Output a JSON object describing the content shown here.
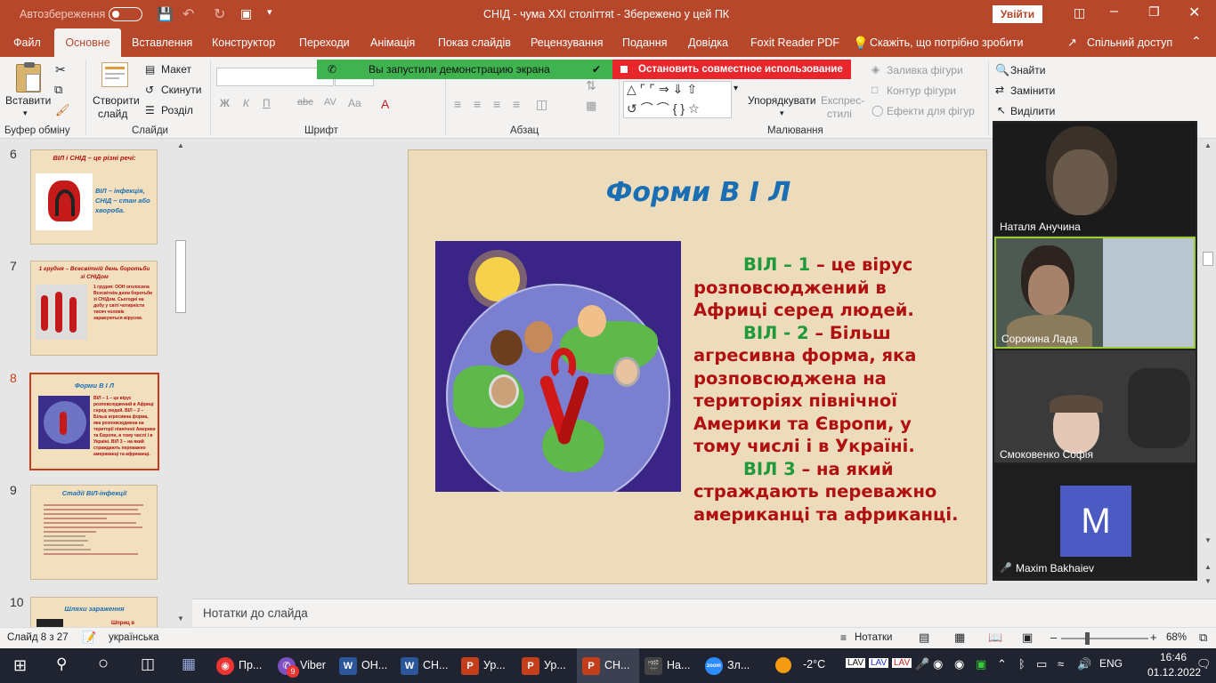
{
  "titlebar": {
    "autosave_label": "Автозбереження",
    "autosave_state": "Вимк.",
    "title": "СНІД - чума ХХІ століттяt  -  Збережено у цей ПК",
    "signin": "Увійти"
  },
  "tabs": [
    "Файл",
    "Основне",
    "Вставлення",
    "Конструктор",
    "Переходи",
    "Анімація",
    "Показ слайдів",
    "Рецензування",
    "Подання",
    "Довідка",
    "Foxit Reader PDF",
    "Скажіть, що потрібно зробити",
    "Спільний доступ"
  ],
  "ribbon": {
    "paste": "Вставити",
    "new_slide_1": "Створити",
    "new_slide_2": "слайд",
    "layout": "Макет",
    "reset": "Скинути",
    "section": "Розділ",
    "group_clipboard": "Буфер обміну",
    "group_slides": "Слайди",
    "group_font": "Шрифт",
    "group_paragraph": "Абзац",
    "group_drawing": "Малювання",
    "arrange": "Упорядкувати",
    "quick_styles_1": "Експрес-",
    "quick_styles_2": "стилі",
    "shape_fill": "Заливка фігури",
    "shape_outline": "Контур фігури",
    "shape_effects": "Ефекти для фігур",
    "find": "Знайти",
    "replace": "Замінити",
    "select": "Виділити",
    "font_buttons": [
      "Ж",
      "К",
      "П",
      "abc",
      "AV",
      "Aa"
    ]
  },
  "share_banner": {
    "status": "Вы запустили демонстрацию экрана",
    "stop": "Остановить совместное использование"
  },
  "thumbnails": [
    {
      "num": "6",
      "title": "ВІЛ і СНІД – це різні речі:",
      "body": "ВІЛ – інфекція, СНІД – стан або хвороба."
    },
    {
      "num": "7",
      "title": "1 грудня – Всесвітній день боротьби зі СНІДом",
      "body": "1 грудня: ООН оголосила Всесвітнім днем боротьби зі СНІДом. Сьогодні на добу у світі чотирністи тисяч чоловік заражуються вірусом."
    },
    {
      "num": "8",
      "title": "Форми В І Л",
      "body": "ВІЛ – 1 – це вірус розповсюджений в Африці серед людей. ВІЛ – 2 – Більш агресивна форма, яка розповсюджена на території північної Америки та Європи, в тому числі і в Україні. ВІЛ 3 – на який страждають переважно американці та африканці."
    },
    {
      "num": "9",
      "title": "Стадії ВІЛ-інфекції",
      "body": ""
    },
    {
      "num": "10",
      "title": "Шляхи зараження",
      "body": "Шприц в"
    }
  ],
  "slide": {
    "title": "Форми В І Л",
    "p1_green": "ВІЛ – 1",
    "p1_rest": " – це вірус",
    "p1_l2": "розповсюджений в",
    "p1_l3": "Африці серед людей.",
    "p2_green": "ВІЛ - 2",
    "p2_rest": " – Більш",
    "p2_l2": "агресивна форма, яка",
    "p2_l3": "розповсюджена на",
    "p2_l4": "територіях північної",
    "p2_l5": "Америки та Європи, у",
    "p2_l6": "тому числі і в Україні.",
    "p3_green": "ВІЛ 3",
    "p3_rest": " – на який",
    "p3_l2": "страждають переважно",
    "p3_l3": "американці та африканці."
  },
  "video_tiles": [
    {
      "name": "Наталя Анучина"
    },
    {
      "name": "Сорокина Лада"
    },
    {
      "name": "Смоковенко Софія"
    },
    {
      "name": "Maxim Bakhaiev",
      "avatar_letter": "M"
    }
  ],
  "notes_label": "Нотатки до слайда",
  "status": {
    "slide_info": "Слайд 8 з 27",
    "language": "українська",
    "notes_btn": "Нотатки",
    "zoom": "68%"
  },
  "taskbar": {
    "items": [
      "Пр...",
      "Viber",
      "ОН...",
      "СН...",
      "Ур...",
      "Ур...",
      "СН...",
      "На...",
      "Зл..."
    ],
    "viber_badge": "9",
    "weather": "-2°C",
    "lang": "ENG",
    "time": "16:46",
    "date": "01.12.2022"
  },
  "colors": {
    "accent": "#b7472a",
    "slide_red": "#b01010",
    "slide_green": "#1f9a3a",
    "slide_title_blue": "#1a6fb4",
    "banner_green": "#3fb34f",
    "banner_red": "#e8262b"
  }
}
